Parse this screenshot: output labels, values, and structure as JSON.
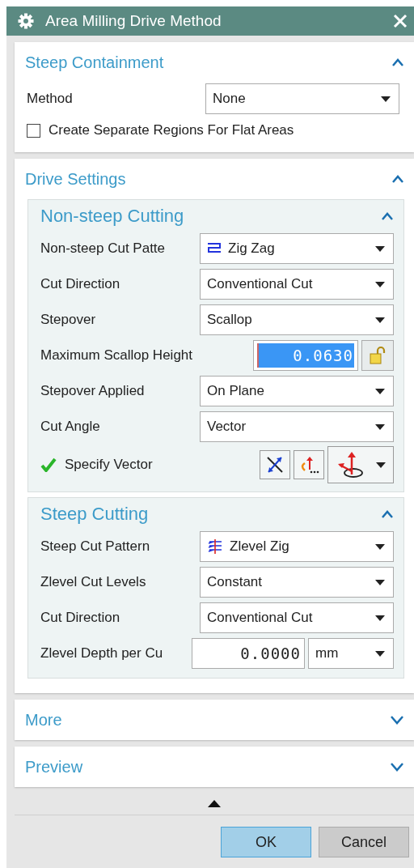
{
  "window": {
    "title": "Area Milling Drive Method"
  },
  "sections": [
    {
      "title": "Steep Containment",
      "expanded": true,
      "rows": [
        {
          "kind": "dropdown",
          "label": "Method",
          "value": "None"
        },
        {
          "kind": "checkbox",
          "label": "Create Separate Regions For Flat Areas",
          "checked": false
        }
      ]
    },
    {
      "title": "Drive Settings",
      "expanded": true,
      "groups": [
        {
          "title": "Non-steep Cutting",
          "expanded": true,
          "rows": [
            {
              "kind": "dropdown",
              "label": "Non-steep Cut Patte",
              "value": "Zig Zag",
              "has_icon": true
            },
            {
              "kind": "dropdown",
              "label": "Cut Direction",
              "value": "Conventional Cut"
            },
            {
              "kind": "dropdown",
              "label": "Stepover",
              "value": "Scallop"
            },
            {
              "kind": "number-lock",
              "label": "Maximum Scallop Height",
              "value": "0.0630",
              "selected": true
            },
            {
              "kind": "dropdown",
              "label": "Stepover Applied",
              "value": "On Plane"
            },
            {
              "kind": "dropdown",
              "label": "Cut Angle",
              "value": "Vector"
            },
            {
              "kind": "vector",
              "label": "Specify Vector",
              "specified": true
            }
          ]
        },
        {
          "title": "Steep Cutting",
          "expanded": true,
          "rows": [
            {
              "kind": "dropdown",
              "label": "Steep Cut Pattern",
              "value": "Zlevel Zig",
              "has_icon": true
            },
            {
              "kind": "dropdown",
              "label": "Zlevel Cut Levels",
              "value": "Constant"
            },
            {
              "kind": "dropdown",
              "label": "Cut Direction",
              "value": "Conventional Cut"
            },
            {
              "kind": "number-unit",
              "label": "Zlevel Depth per Cu",
              "value": "0.0000",
              "unit": "mm"
            }
          ]
        }
      ]
    },
    {
      "title": "More",
      "expanded": false
    },
    {
      "title": "Preview",
      "expanded": false
    }
  ],
  "buttons": [
    {
      "label": "OK",
      "kind": "default"
    },
    {
      "label": "Cancel",
      "kind": "normal"
    }
  ]
}
